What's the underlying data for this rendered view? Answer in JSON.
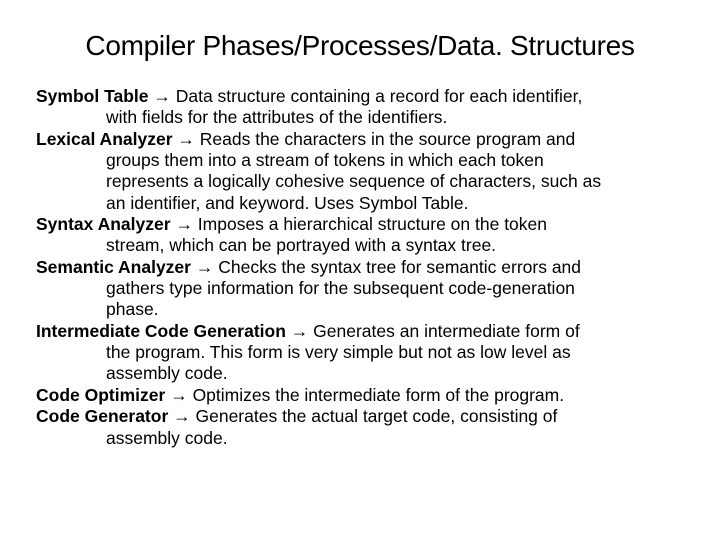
{
  "title": "Compiler Phases/Processes/Data. Structures",
  "arrow": "→",
  "items": [
    {
      "term": "Symbol Table",
      "def_first": " Data structure containing a record for each identifier,",
      "cont": [
        "with fields for the attributes of the identifiers."
      ]
    },
    {
      "term": "Lexical Analyzer",
      "def_first": " Reads the characters in the source program and",
      "cont": [
        "groups them into a stream of tokens in which each token",
        "represents a logically cohesive sequence of characters, such as",
        "an identifier, and keyword.  Uses Symbol Table."
      ]
    },
    {
      "term": "Syntax Analyzer",
      "def_first": " Imposes a hierarchical structure on the token",
      "cont": [
        "stream, which can be portrayed with a syntax tree."
      ]
    },
    {
      "term": "Semantic Analyzer",
      "def_first": " Checks the syntax tree for semantic errors and",
      "cont": [
        "gathers type information for the subsequent code-generation",
        "phase."
      ]
    },
    {
      "term": "Intermediate Code Generation",
      "def_first": " Generates an intermediate form of",
      "cont": [
        "the program.  This form is very simple but not as low level as",
        "assembly code."
      ]
    },
    {
      "term": "Code Optimizer",
      "def_first": " Optimizes the intermediate form of the program.",
      "cont": []
    },
    {
      "term": "Code Generator",
      "def_first": " Generates the actual target code, consisting of",
      "cont": [
        "assembly code."
      ]
    }
  ]
}
